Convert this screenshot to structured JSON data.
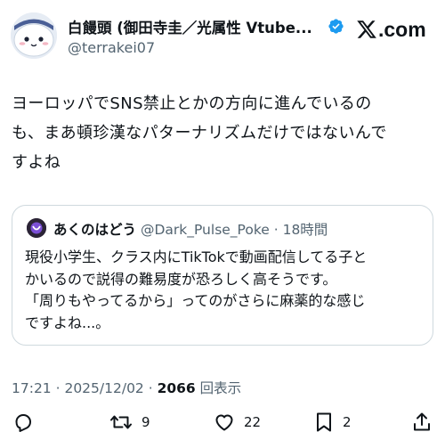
{
  "header": {
    "display_name": "白饅頭 (御田寺圭／光属性 Vtube...",
    "handle": "@terrakei07",
    "site_logo": ".com"
  },
  "post": {
    "text_lines": [
      "ヨーロッパでSNS禁止とかの方向に進んでいるの",
      "も、まあ頓珍漢なパターナリズムだけではないんで",
      "すよね"
    ]
  },
  "quote": {
    "name": "あくのはどう",
    "handle": "@Dark_Pulse_Poke",
    "separator": " · ",
    "time": "18時間",
    "text_lines": [
      "現役小学生、クラス内にTikTokで動画配信してる子と",
      "かいるので説得の難易度が恐ろしく高そうです。",
      "「周りもやってるから」ってのがさらに麻薬的な感じ",
      "ですよね...。"
    ]
  },
  "meta": {
    "time": "17:21",
    "separator": " · ",
    "date": "2025/12/02",
    "separator2": " · ",
    "views_count": "2066",
    "views_label": " 回表示"
  },
  "actions": {
    "reply_count": "",
    "retweet_count": "9",
    "like_count": "22",
    "bookmark_count": "2"
  },
  "colors": {
    "text": "#0f1419",
    "secondary": "#536471",
    "verified": "#1d9bf0",
    "border": "#cfd9de"
  }
}
